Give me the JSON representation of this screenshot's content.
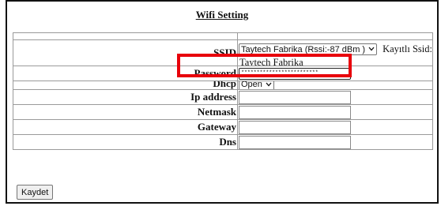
{
  "page": {
    "title": "Wifi Setting"
  },
  "form": {
    "ssid": {
      "label": "SSID",
      "selected": "Taytech Fabrika (Rssi:-87 dBm )",
      "saved_label": "Kayıtlı Ssid:",
      "saved_value": "Taytech Fabrika"
    },
    "password": {
      "label": "Password",
      "masked_value": "*************************"
    },
    "dhcp": {
      "label": "Dhcp",
      "selected": "Open"
    },
    "ip_address": {
      "label": "Ip address",
      "value": ""
    },
    "netmask": {
      "label": "Netmask",
      "value": ""
    },
    "gateway": {
      "label": "Gateway",
      "value": ""
    },
    "dns": {
      "label": "Dns",
      "value": ""
    }
  },
  "actions": {
    "save_label": "Kaydet"
  },
  "colors": {
    "highlight": "#e8000b",
    "border": "#9a9a9a"
  },
  "icons": {
    "dropdown": "chevron-down-icon"
  }
}
